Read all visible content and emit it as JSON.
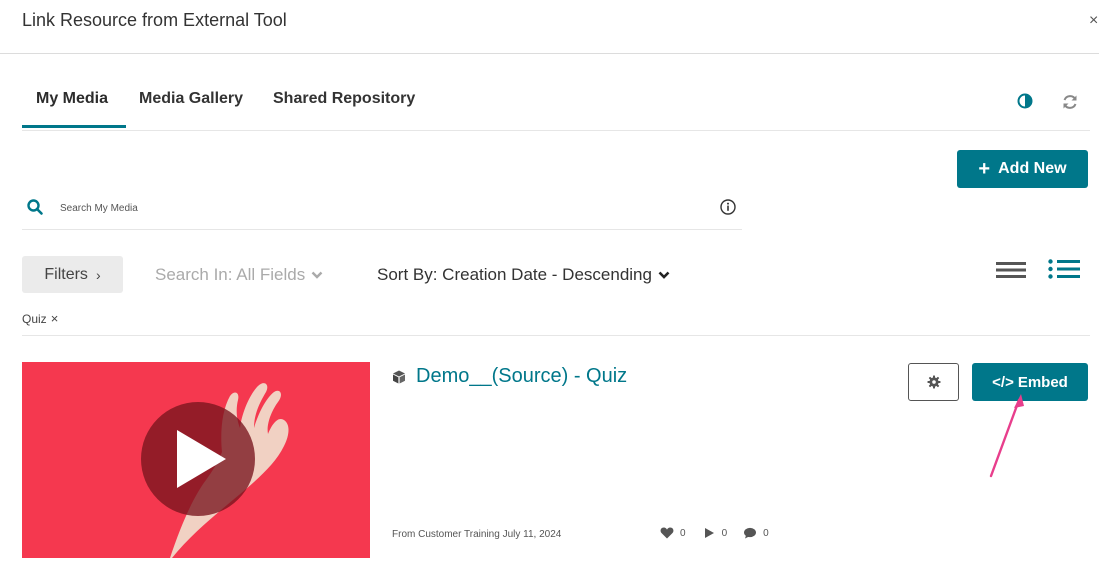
{
  "dialog": {
    "title": "Link Resource from External Tool",
    "close": "×"
  },
  "tabs": [
    {
      "label": "My Media"
    },
    {
      "label": "Media Gallery"
    },
    {
      "label": "Shared Repository"
    }
  ],
  "toolbar": {
    "add_new_label": "Add New"
  },
  "search": {
    "placeholder": "Search My Media"
  },
  "filters": {
    "filters_label": "Filters",
    "search_in_label": "Search In: All Fields",
    "sort_by_label": "Sort By: Creation Date - Descending",
    "active_tag": "Quiz"
  },
  "entry": {
    "title": "Demo__(Source) - Quiz",
    "meta": "From Customer Training July 11, 2024",
    "likes": "0",
    "plays": "0",
    "comments": "0",
    "embed_label": "Embed",
    "embed_icon": "</>"
  },
  "colors": {
    "accent": "#00778a",
    "thumbnail_bg": "#f5384f",
    "annotation_arrow": "#e83e8c"
  }
}
